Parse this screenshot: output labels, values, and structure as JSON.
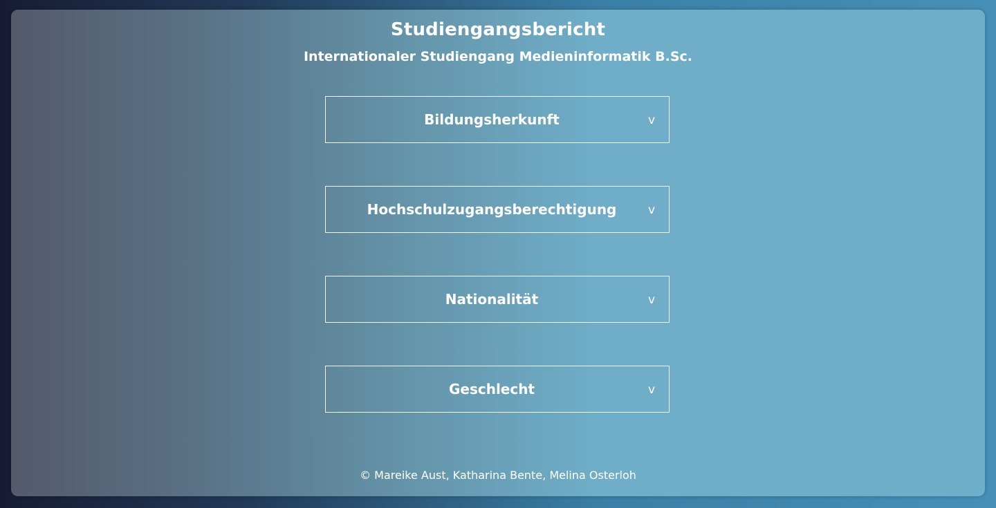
{
  "header": {
    "title": "Studiengangsbericht",
    "subtitle": "Internationaler Studiengang Medieninformatik B.Sc."
  },
  "sections": [
    {
      "label": "Bildungsherkunft",
      "icon": "chevron-down-icon",
      "glyph": "v"
    },
    {
      "label": "Hochschulzugangsberechtigung",
      "icon": "chevron-down-icon",
      "glyph": "v"
    },
    {
      "label": "Nationalität",
      "icon": "chevron-down-icon",
      "glyph": "v"
    },
    {
      "label": "Geschlecht",
      "icon": "chevron-down-icon",
      "glyph": "v"
    }
  ],
  "footer": {
    "text": "© Mareike Aust, Katharina Bente, Melina Osterloh"
  },
  "colors": {
    "text": "#ffffff",
    "border": "#eef4f8",
    "gradient_left": "#545a6c",
    "gradient_right": "#6faec9"
  }
}
